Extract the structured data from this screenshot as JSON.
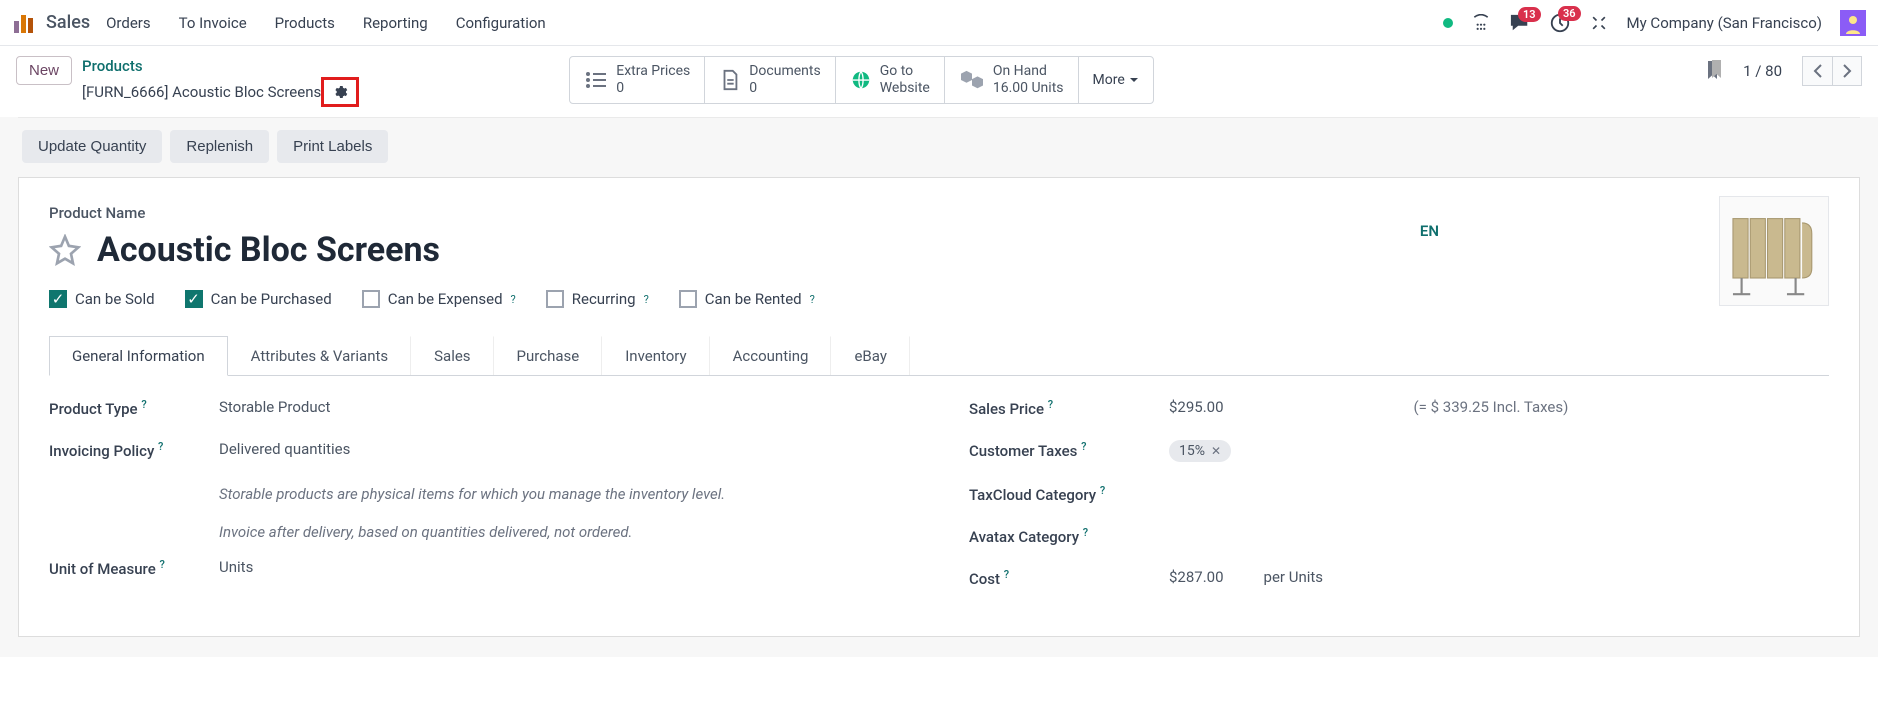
{
  "navbar": {
    "app_name": "Sales",
    "menu": [
      "Orders",
      "To Invoice",
      "Products",
      "Reporting",
      "Configuration"
    ],
    "badges": {
      "messages": "13",
      "activities": "36"
    },
    "company": "My Company (San Francisco)"
  },
  "controlbar": {
    "new_label": "New",
    "breadcrumb_link": "Products",
    "breadcrumb_current": "[FURN_6666] Acoustic Bloc Screens",
    "stats": [
      {
        "label": "Extra Prices",
        "value": "0"
      },
      {
        "label": "Documents",
        "value": "0"
      },
      {
        "label": "Go to",
        "value": "Website"
      },
      {
        "label": "On Hand",
        "value": "16.00 Units"
      }
    ],
    "more_label": "More",
    "pager": "1 / 80"
  },
  "actions": {
    "update_qty": "Update Quantity",
    "replenish": "Replenish",
    "print_labels": "Print Labels"
  },
  "form": {
    "product_name_label": "Product Name",
    "product_name": "Acoustic Bloc Screens",
    "lang": "EN",
    "checkboxes": {
      "can_sold": "Can be Sold",
      "can_purchased": "Can be Purchased",
      "can_expensed": "Can be Expensed",
      "recurring": "Recurring",
      "can_rented": "Can be Rented"
    },
    "tabs": [
      "General Information",
      "Attributes & Variants",
      "Sales",
      "Purchase",
      "Inventory",
      "Accounting",
      "eBay"
    ],
    "left": {
      "product_type_lbl": "Product Type",
      "product_type_val": "Storable Product",
      "invoicing_policy_lbl": "Invoicing Policy",
      "invoicing_policy_val": "Delivered quantities",
      "help1": "Storable products are physical items for which you manage the inventory level.",
      "help2": "Invoice after delivery, based on quantities delivered, not ordered.",
      "uom_lbl": "Unit of Measure",
      "uom_val": "Units"
    },
    "right": {
      "sales_price_lbl": "Sales Price",
      "sales_price_val": "$295.00",
      "sales_price_incl": "(= $ 339.25 Incl. Taxes)",
      "customer_taxes_lbl": "Customer Taxes",
      "customer_taxes_tag": "15%",
      "taxcloud_lbl": "TaxCloud Category",
      "avatax_lbl": "Avatax Category",
      "cost_lbl": "Cost",
      "cost_val": "$287.00",
      "cost_per": "per Units"
    }
  }
}
